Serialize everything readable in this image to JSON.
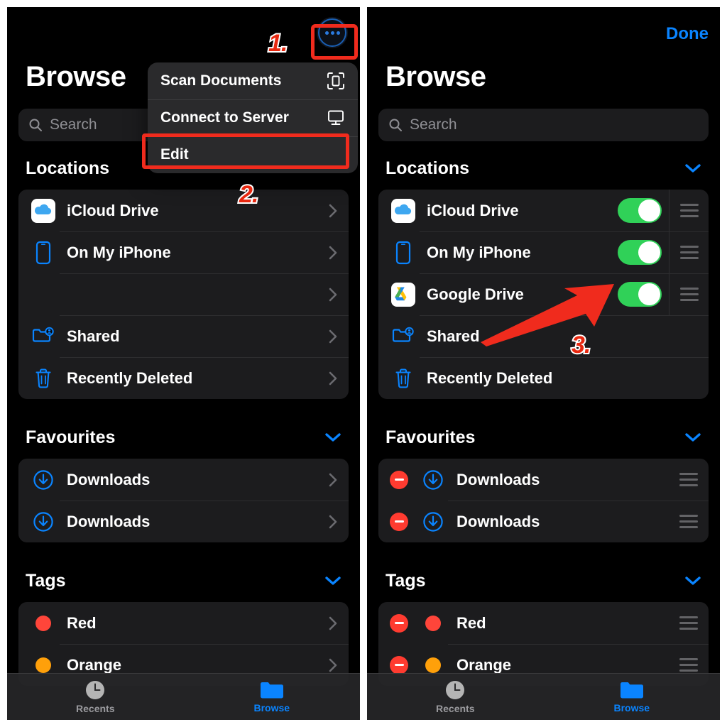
{
  "accent": {
    "blue": "#0a84ff",
    "green": "#30d158",
    "red": "#ff3b30",
    "annotation_red": "#f02b1d",
    "card_bg": "#1c1c1e",
    "screen_bg": "#000000"
  },
  "left_panel": {
    "header": {
      "title": "Browse",
      "more_button": "more-options"
    },
    "search": {
      "placeholder": "Search"
    },
    "menu": {
      "items": [
        {
          "label": "Scan Documents",
          "icon": "scan-documents-icon"
        },
        {
          "label": "Connect to Server",
          "icon": "display-icon"
        },
        {
          "label": "Edit",
          "icon": ""
        }
      ]
    },
    "sections": [
      {
        "title": "Locations",
        "rows": [
          {
            "label": "iCloud Drive",
            "icon": "icloud-drive-icon"
          },
          {
            "label": "On My iPhone",
            "icon": "iphone-icon"
          },
          {
            "label": "",
            "icon": "blank-icon"
          },
          {
            "label": "Shared",
            "icon": "shared-folder-icon"
          },
          {
            "label": "Recently Deleted",
            "icon": "trash-icon"
          }
        ]
      },
      {
        "title": "Favourites",
        "rows": [
          {
            "label": "Downloads",
            "icon": "download-circle-icon"
          },
          {
            "label": "Downloads",
            "icon": "download-circle-icon"
          }
        ]
      },
      {
        "title": "Tags",
        "rows": [
          {
            "label": "Red",
            "icon": "tag-dot-icon",
            "color": "#ff453a"
          },
          {
            "label": "Orange",
            "icon": "tag-dot-icon",
            "color": "#ffa00a"
          }
        ]
      }
    ],
    "tabs": [
      {
        "label": "Recents",
        "icon": "clock-icon",
        "active": false
      },
      {
        "label": "Browse",
        "icon": "folder-icon",
        "active": true
      }
    ]
  },
  "right_panel": {
    "header": {
      "title": "Browse",
      "done_label": "Done"
    },
    "search": {
      "placeholder": "Search"
    },
    "sections": [
      {
        "title": "Locations",
        "rows": [
          {
            "label": "iCloud Drive",
            "icon": "icloud-drive-icon",
            "toggle": "on"
          },
          {
            "label": "On My iPhone",
            "icon": "iphone-icon",
            "toggle": "on"
          },
          {
            "label": "Google Drive",
            "icon": "google-drive-icon",
            "toggle": "on"
          },
          {
            "label": "Shared",
            "icon": "shared-folder-icon",
            "toggle": "none"
          },
          {
            "label": "Recently Deleted",
            "icon": "trash-icon",
            "toggle": "none"
          }
        ]
      },
      {
        "title": "Favourites",
        "rows": [
          {
            "label": "Downloads",
            "icon": "download-circle-icon",
            "minus": true
          },
          {
            "label": "Downloads",
            "icon": "download-circle-icon",
            "minus": true
          }
        ]
      },
      {
        "title": "Tags",
        "rows": [
          {
            "label": "Red",
            "icon": "tag-dot-icon",
            "color": "#ff453a",
            "minus": true
          },
          {
            "label": "Orange",
            "icon": "tag-dot-icon",
            "color": "#ffa00a",
            "minus": true
          }
        ]
      }
    ],
    "tabs": [
      {
        "label": "Recents",
        "icon": "clock-icon",
        "active": false
      },
      {
        "label": "Browse",
        "icon": "folder-icon",
        "active": true
      }
    ]
  },
  "annotations": [
    {
      "id": "step1",
      "label": "1."
    },
    {
      "id": "step2",
      "label": "2."
    },
    {
      "id": "step3",
      "label": "3."
    }
  ]
}
